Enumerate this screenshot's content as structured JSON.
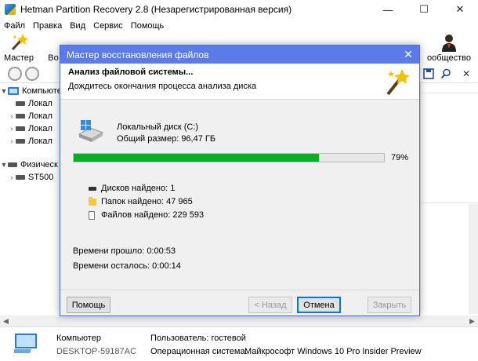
{
  "app": {
    "title": "Hetman Partition Recovery 2.8 (Незарегистрированная версия)",
    "menu": [
      "Файл",
      "Правка",
      "Вид",
      "Сервис",
      "Помощь"
    ],
    "ribbon": {
      "master_label": "Мастер",
      "partial_label": "Во",
      "community_label": "ообщество"
    },
    "tree": {
      "computer_label": "Компьютер",
      "local_items": [
        "Локал",
        "Локал",
        "Локал",
        "Локал"
      ],
      "physical_label": "Физическ",
      "st_item": "ST500"
    }
  },
  "dialog": {
    "title": "Мастер восстановления файлов",
    "header_title": "Анализ файловой системы...",
    "header_sub": "Дождитесь окончания процесса анализа диска",
    "disk_name": "Локальный диск (C:)",
    "disk_size": "Общий размер: 96,47 ГБ",
    "progress_percent": 79,
    "progress_label": "79%",
    "stats": {
      "disks": "Дисков найдено: 1",
      "folders": "Папок найдено: 47 965",
      "files": "Файлов найдено: 229 593"
    },
    "time_elapsed": "Времени прошло: 0:00:53",
    "time_left": "Времени осталось: 0:00:14",
    "buttons": {
      "help": "Помощь",
      "back": "< Назад",
      "cancel": "Отмена",
      "close": "Закрыть"
    }
  },
  "status": {
    "computer_label": "Компьютер",
    "computer_name": "DESKTOP-59187AC",
    "user_label": "Пользователь: гостевой",
    "os_label": "Операционная система:",
    "os_value": "Майкрософт Windows 10 Pro Insider Preview"
  },
  "colors": {
    "dialog_title": "#5b7ce8",
    "progress": "#06b025"
  }
}
